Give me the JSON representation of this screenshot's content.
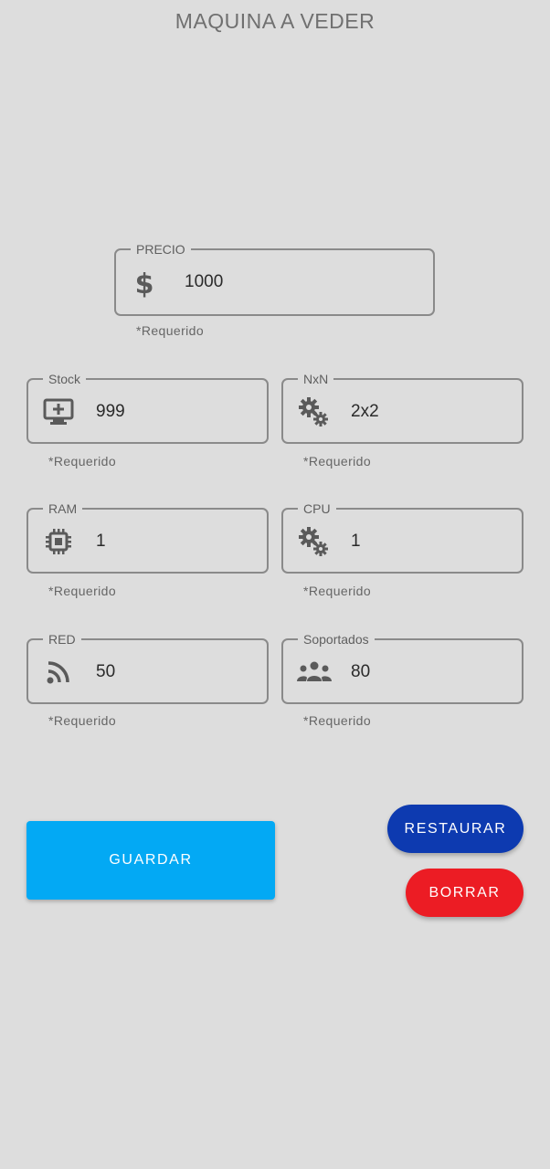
{
  "header": {
    "title": "MAQUINA A VEDER"
  },
  "fields": {
    "precio": {
      "label": "PRECIO",
      "value": "1000",
      "helper": "*Requerido",
      "icon": "dollar-icon"
    },
    "stock": {
      "label": "Stock",
      "value": "999",
      "helper": "*Requerido",
      "icon": "monitor-add-icon"
    },
    "nxn": {
      "label": "NxN",
      "value": "2x2",
      "helper": "*Requerido",
      "icon": "gears-icon"
    },
    "ram": {
      "label": "RAM",
      "value": "1",
      "helper": "*Requerido",
      "icon": "chip-icon"
    },
    "cpu": {
      "label": "CPU",
      "value": "1",
      "helper": "*Requerido",
      "icon": "gears-icon"
    },
    "red": {
      "label": "RED",
      "value": "50",
      "helper": "*Requerido",
      "icon": "rss-icon"
    },
    "soportados": {
      "label": "Soportados",
      "value": "80",
      "helper": "*Requerido",
      "icon": "users-icon"
    }
  },
  "buttons": {
    "guardar": "GUARDAR",
    "restaurar": "RESTAURAR",
    "borrar": "BORRAR"
  },
  "colors": {
    "background": "#dddddd",
    "guardar": "#03a9f4",
    "restaurar": "#0d3ab0",
    "borrar": "#ec1c24",
    "border": "#8a8a8a"
  }
}
